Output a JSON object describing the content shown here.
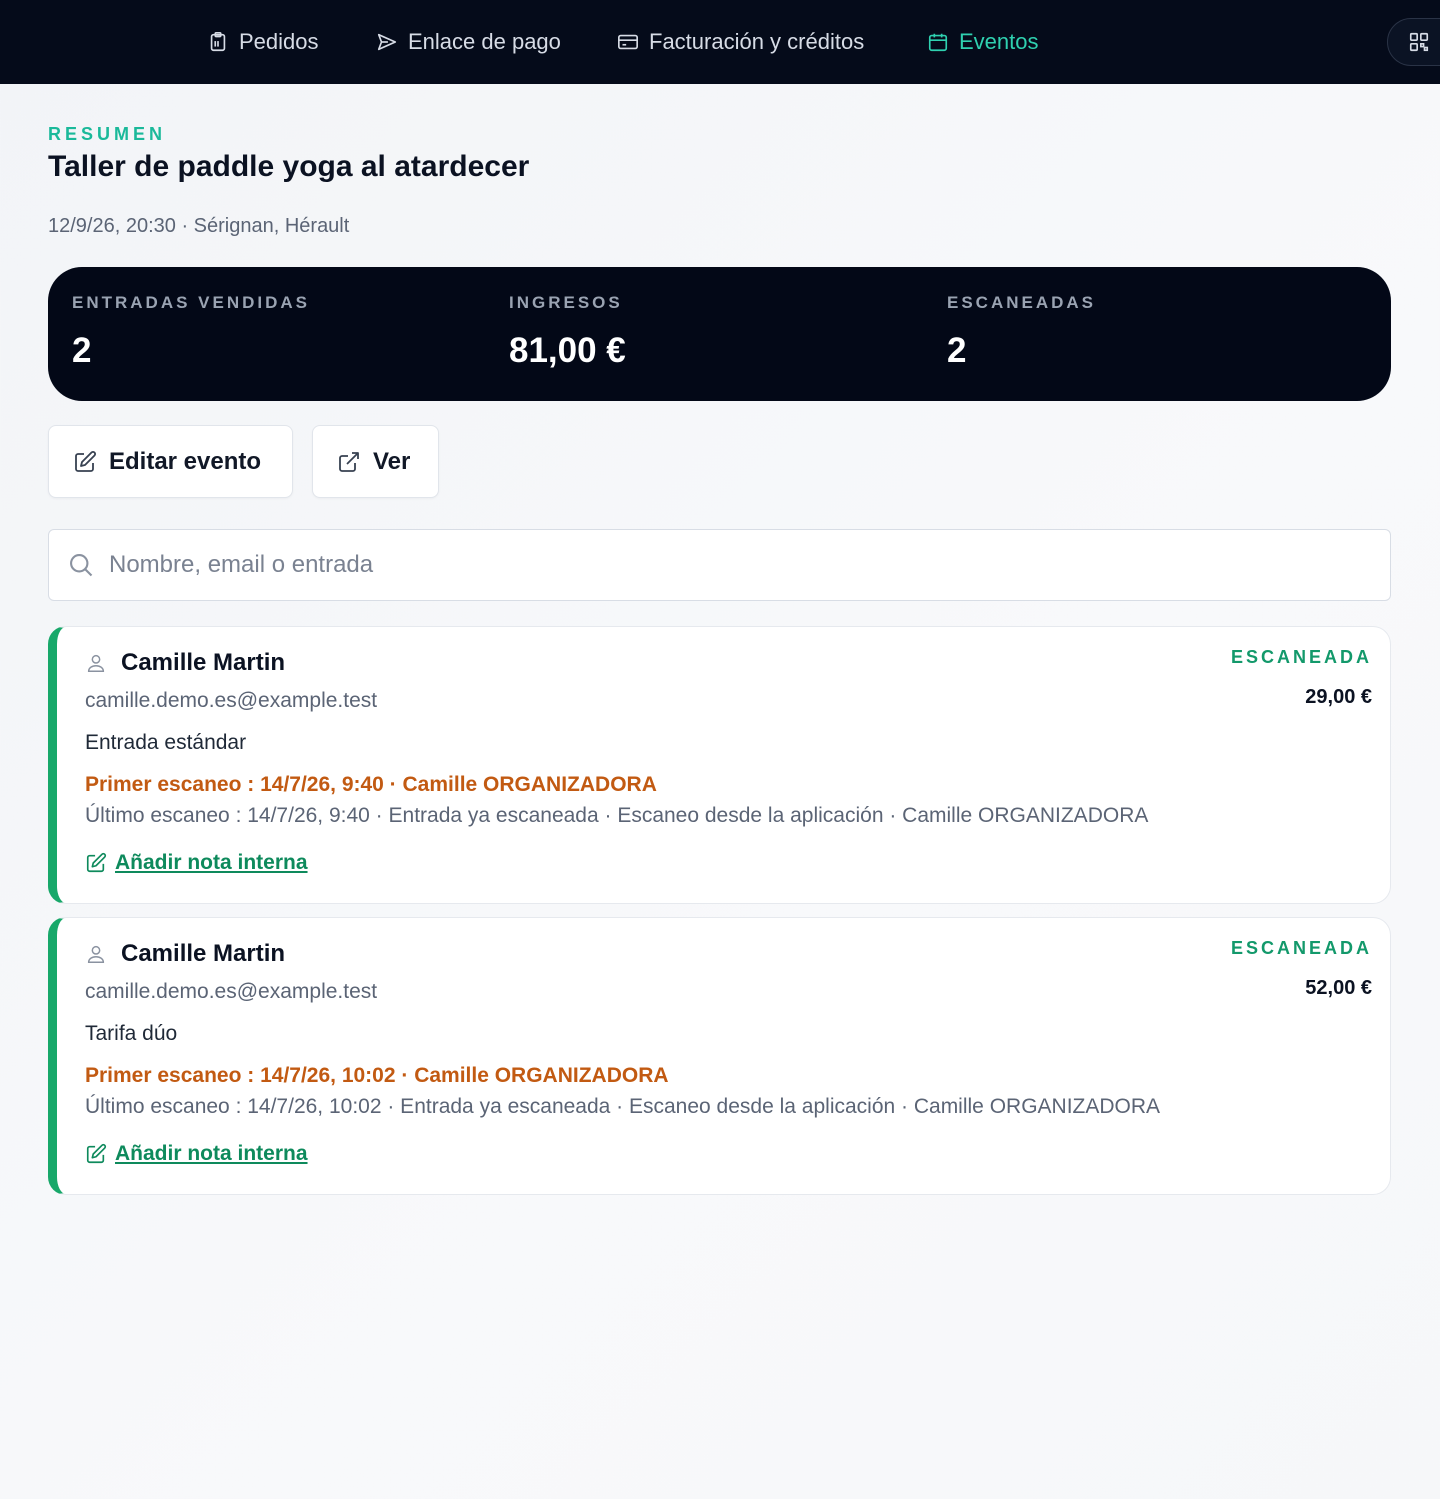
{
  "nav": {
    "items": [
      {
        "label": "Pedidos",
        "icon": "clipboard-icon"
      },
      {
        "label": "Enlace de pago",
        "icon": "send-icon"
      },
      {
        "label": "Facturación y créditos",
        "icon": "credit-card-icon"
      },
      {
        "label": "Eventos",
        "icon": "calendar-icon",
        "active": true
      }
    ],
    "qr_icon": "qr-code-icon"
  },
  "event": {
    "eyebrow": "RESUMEN",
    "title": "Taller de paddle yoga al atardecer",
    "meta": "12/9/26, 20:30 · Sérignan, Hérault"
  },
  "stats": [
    {
      "label": "ENTRADAS VENDIDAS",
      "value": "2"
    },
    {
      "label": "INGRESOS",
      "value": "81,00 €"
    },
    {
      "label": "ESCANEADAS",
      "value": "2"
    }
  ],
  "actions": {
    "edit_label": "Editar evento",
    "view_label": "Ver"
  },
  "search": {
    "placeholder": "Nombre, email o entrada",
    "value": ""
  },
  "attendees": [
    {
      "name": "Camille Martin",
      "email": "camille.demo.es@example.test",
      "ticket": "Entrada estándar",
      "first_scan": "Primer escaneo : 14/7/26, 9:40 · Camille ORGANIZADORA",
      "last_scan": "Último escaneo : 14/7/26, 9:40 · Entrada ya escaneada · Escaneo desde la aplicación · Camille ORGANIZADORA",
      "note_label": "Añadir nota interna",
      "status": "ESCANEADA",
      "price": "29,00 €"
    },
    {
      "name": "Camille Martin",
      "email": "camille.demo.es@example.test",
      "ticket": "Tarifa dúo",
      "first_scan": "Primer escaneo : 14/7/26, 10:02 · Camille ORGANIZADORA",
      "last_scan": "Último escaneo : 14/7/26, 10:02 · Entrada ya escaneada · Escaneo desde la aplicación · Camille ORGANIZADORA",
      "note_label": "Añadir nota interna",
      "status": "ESCANEADA",
      "price": "52,00 €"
    }
  ],
  "colors": {
    "nav_bg": "#050b1a",
    "accent": "#1ab99a",
    "scanned": "#18a86a",
    "first_scan": "#c25a12"
  }
}
